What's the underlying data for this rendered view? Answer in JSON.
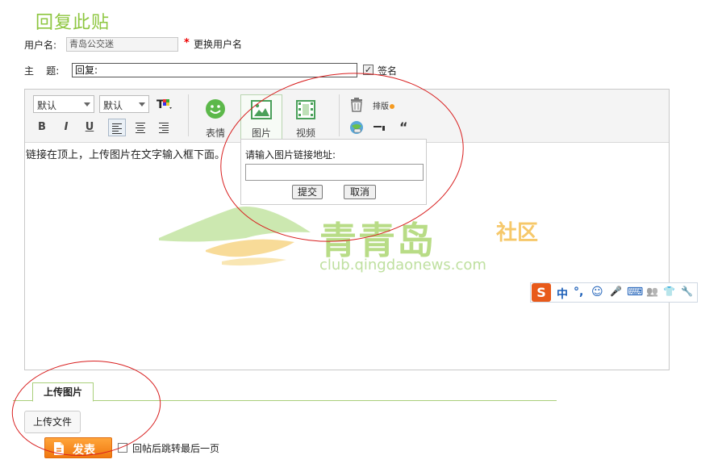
{
  "page": {
    "title": "回复此贴"
  },
  "username": {
    "label": "用户名:",
    "value": "青岛公交迷",
    "required_mark": "*",
    "change_link": "更换用户名"
  },
  "subject": {
    "label": "主    题:",
    "value": "回复:",
    "signature_label": "签名",
    "signature_checked": true
  },
  "editor": {
    "font_family": "默认",
    "font_size": "默认",
    "format_buttons": [
      "B",
      "I",
      "U"
    ],
    "big_buttons": [
      {
        "label": "表情",
        "icon": "smiley-icon"
      },
      {
        "label": "图片",
        "icon": "image-icon"
      },
      {
        "label": "视频",
        "icon": "video-icon"
      }
    ],
    "layout_label": "排版",
    "quote_glyph": "“",
    "content": "链接在顶上，上传图片在文字输入框下面。"
  },
  "image_popup": {
    "label": "请输入图片链接地址:",
    "url_value": "",
    "submit_label": "提交",
    "cancel_label": "取消"
  },
  "watermark": {
    "brand": "青青岛",
    "brand_suffix": "社区",
    "url": "club.qingdaonews.com"
  },
  "ime": {
    "logo": "S",
    "items": [
      "中",
      "°,",
      "☺",
      "🎤",
      "⌨",
      "👥",
      "👕",
      "🔧"
    ]
  },
  "upload": {
    "tab_label": "上传图片",
    "button_label": "上传文件"
  },
  "submit": {
    "button_label": "发表",
    "jump_label": "回帖后跳转最后一页",
    "jump_checked": false
  },
  "colors": {
    "accent_green": "#8dc63f",
    "post_orange": "#f07810",
    "annotation_red": "#d81e1e"
  }
}
